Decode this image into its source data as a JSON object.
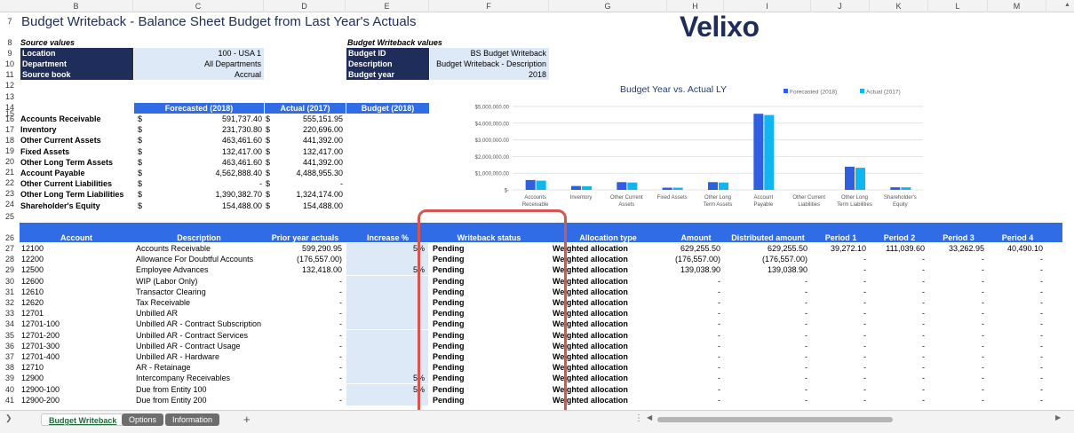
{
  "column_letters": [
    "B",
    "C",
    "D",
    "E",
    "F",
    "G",
    "H",
    "I",
    "J",
    "K",
    "L",
    "M"
  ],
  "title": "Budget Writeback - Balance Sheet Budget from Last Year's Actuals",
  "logo": "Velixo",
  "source_values": {
    "header": "Source values",
    "rows": [
      {
        "label": "Location",
        "value": "100 - USA 1"
      },
      {
        "label": "Department",
        "value": "All Departments"
      },
      {
        "label": "Source book",
        "value": "Accrual"
      }
    ]
  },
  "writeback_values": {
    "header": "Budget Writeback values",
    "rows": [
      {
        "label": "Budget ID",
        "value": "BS Budget Writeback"
      },
      {
        "label": "Description",
        "value": "Budget Writeback - Description"
      },
      {
        "label": "Budget year",
        "value": "2018"
      }
    ]
  },
  "summary": {
    "headers": [
      "Forecasted (2018)",
      "Actual (2017)",
      "Budget (2018)"
    ],
    "rows": [
      {
        "label": "Accounts Receivable",
        "cur1": "$",
        "forecast": "591,737.40",
        "cur2": "$",
        "actual": "555,151.95"
      },
      {
        "label": "Inventory",
        "cur1": "$",
        "forecast": "231,730.80",
        "cur2": "$",
        "actual": "220,696.00"
      },
      {
        "label": "Other Current Assets",
        "cur1": "$",
        "forecast": "463,461.60",
        "cur2": "$",
        "actual": "441,392.00"
      },
      {
        "label": "Fixed Assets",
        "cur1": "$",
        "forecast": "132,417.00",
        "cur2": "$",
        "actual": "132,417.00"
      },
      {
        "label": "Other Long Term Assets",
        "cur1": "$",
        "forecast": "463,461.60",
        "cur2": "$",
        "actual": "441,392.00"
      },
      {
        "label": "Account Payable",
        "cur1": "$",
        "forecast": "4,562,888.40",
        "cur2": "$",
        "actual": "4,488,955.30"
      },
      {
        "label": "Other Current Liabilities",
        "cur1": "$",
        "forecast": "-",
        "cur2": "$",
        "actual": "-"
      },
      {
        "label": "Other Long Term Liabilities",
        "cur1": "$",
        "forecast": "1,390,382.70",
        "cur2": "$",
        "actual": "1,324,174.00"
      },
      {
        "label": "Shareholder's Equity",
        "cur1": "$",
        "forecast": "154,488.00",
        "cur2": "$",
        "actual": "154,488.00"
      }
    ]
  },
  "chart_data": {
    "type": "bar",
    "title": "Budget Year vs. Actual LY",
    "categories": [
      "Accounts Receivable",
      "Inventory",
      "Other Current Assets",
      "Fixed Assets",
      "Other Long Term Assets",
      "Account Payable",
      "Other Current Liabilities",
      "Other Long Term Liabilities",
      "Shareholder's Equity"
    ],
    "category_lines": [
      [
        "Accounts",
        "Receivable"
      ],
      [
        "Inventory"
      ],
      [
        "Other Current",
        "Assets"
      ],
      [
        "Fixed Assets"
      ],
      [
        "Other Long",
        "Term Assets"
      ],
      [
        "Account",
        "Payable"
      ],
      [
        "Other Current",
        "Liabilities"
      ],
      [
        "Other Long",
        "Term Liabilities"
      ],
      [
        "Shareholder's",
        "Equity"
      ]
    ],
    "series": [
      {
        "name": "Forecasted (2018)",
        "color": "#2f5fe0",
        "values": [
          591737.4,
          231730.8,
          463461.6,
          132417.0,
          463461.6,
          4562888.4,
          0,
          1390382.7,
          154488.0
        ]
      },
      {
        "name": "Actual (2017)",
        "color": "#11b5f0",
        "values": [
          555151.95,
          220696.0,
          441392.0,
          132417.0,
          441392.0,
          4488955.3,
          0,
          1324174.0,
          154488.0
        ]
      }
    ],
    "yticks": [
      "$-",
      "$1,000,000.00",
      "$2,000,000.00",
      "$3,000,000.00",
      "$4,000,000.00",
      "$5,000,000.00"
    ],
    "ylim": [
      0,
      5000000
    ],
    "legend": "top-right",
    "grid": true
  },
  "table": {
    "headers": [
      "Account",
      "Description",
      "Prior year actuals",
      "Increase %",
      "Writeback status",
      "Allocation type",
      "Amount",
      "Distributed amount",
      "Period 1",
      "Period 2",
      "Period 3",
      "Period 4"
    ],
    "rows": [
      {
        "row": "27",
        "account": "12100",
        "desc": "Accounts Receivable",
        "prior": "599,290.95",
        "inc": "5%",
        "status": "Pending",
        "alloc": "Weighted allocation",
        "amount": "629,255.50",
        "dist": "629,255.50",
        "p1": "39,272.10",
        "p2": "111,039.60",
        "p3": "33,262.95",
        "p4": "40,490.10"
      },
      {
        "row": "28",
        "account": "12200",
        "desc": "Allowance For Doubtful Accounts",
        "prior": "(176,557.00)",
        "inc": "",
        "status": "Pending",
        "alloc": "Weighted allocation",
        "amount": "(176,557.00)",
        "dist": "(176,557.00)",
        "p1": "-",
        "p2": "-",
        "p3": "-",
        "p4": "-"
      },
      {
        "row": "29",
        "account": "12500",
        "desc": "Employee Advances",
        "prior": "132,418.00",
        "inc": "5%",
        "status": "Pending",
        "alloc": "Weighted allocation",
        "amount": "139,038.90",
        "dist": "139,038.90",
        "p1": "-",
        "p2": "-",
        "p3": "-",
        "p4": "-"
      },
      {
        "row": "30",
        "account": "12600",
        "desc": "WIP (Labor Only)",
        "prior": "-",
        "inc": "",
        "status": "Pending",
        "alloc": "Weighted allocation",
        "amount": "-",
        "dist": "-",
        "p1": "-",
        "p2": "-",
        "p3": "-",
        "p4": "-"
      },
      {
        "row": "31",
        "account": "12610",
        "desc": "Transactor Clearing",
        "prior": "-",
        "inc": "",
        "status": "Pending",
        "alloc": "Weighted allocation",
        "amount": "-",
        "dist": "-",
        "p1": "-",
        "p2": "-",
        "p3": "-",
        "p4": "-"
      },
      {
        "row": "32",
        "account": "12620",
        "desc": "Tax Receivable",
        "prior": "-",
        "inc": "",
        "status": "Pending",
        "alloc": "Weighted allocation",
        "amount": "-",
        "dist": "-",
        "p1": "-",
        "p2": "-",
        "p3": "-",
        "p4": "-"
      },
      {
        "row": "33",
        "account": "12701",
        "desc": "Unbilled AR",
        "prior": "-",
        "inc": "",
        "status": "Pending",
        "alloc": "Weighted allocation",
        "amount": "-",
        "dist": "-",
        "p1": "-",
        "p2": "-",
        "p3": "-",
        "p4": "-"
      },
      {
        "row": "34",
        "account": "12701-100",
        "desc": "Unbilled AR - Contract Subscription",
        "prior": "-",
        "inc": "",
        "status": "Pending",
        "alloc": "Weighted allocation",
        "amount": "-",
        "dist": "-",
        "p1": "-",
        "p2": "-",
        "p3": "-",
        "p4": "-"
      },
      {
        "row": "35",
        "account": "12701-200",
        "desc": "Unbilled AR - Contract Services",
        "prior": "-",
        "inc": "",
        "status": "Pending",
        "alloc": "Weighted allocation",
        "amount": "-",
        "dist": "-",
        "p1": "-",
        "p2": "-",
        "p3": "-",
        "p4": "-"
      },
      {
        "row": "36",
        "account": "12701-300",
        "desc": "Unbilled AR - Contract Usage",
        "prior": "-",
        "inc": "",
        "status": "Pending",
        "alloc": "Weighted allocation",
        "amount": "-",
        "dist": "-",
        "p1": "-",
        "p2": "-",
        "p3": "-",
        "p4": "-"
      },
      {
        "row": "37",
        "account": "12701-400",
        "desc": "Unbilled AR - Hardware",
        "prior": "-",
        "inc": "",
        "status": "Pending",
        "alloc": "Weighted allocation",
        "amount": "-",
        "dist": "-",
        "p1": "-",
        "p2": "-",
        "p3": "-",
        "p4": "-"
      },
      {
        "row": "38",
        "account": "12710",
        "desc": "AR - Retainage",
        "prior": "-",
        "inc": "",
        "status": "Pending",
        "alloc": "Weighted allocation",
        "amount": "-",
        "dist": "-",
        "p1": "-",
        "p2": "-",
        "p3": "-",
        "p4": "-"
      },
      {
        "row": "39",
        "account": "12900",
        "desc": "Intercompany Receivables",
        "prior": "-",
        "inc": "5%",
        "status": "Pending",
        "alloc": "Weighted allocation",
        "amount": "-",
        "dist": "-",
        "p1": "-",
        "p2": "-",
        "p3": "-",
        "p4": "-"
      },
      {
        "row": "40",
        "account": "12900-100",
        "desc": "Due from Entity 100",
        "prior": "-",
        "inc": "5%",
        "status": "Pending",
        "alloc": "Weighted allocation",
        "amount": "-",
        "dist": "-",
        "p1": "-",
        "p2": "-",
        "p3": "-",
        "p4": "-"
      },
      {
        "row": "41",
        "account": "12900-200",
        "desc": "Due from Entity 200",
        "prior": "-",
        "inc": "",
        "status": "Pending",
        "alloc": "Weighted allocation",
        "amount": "-",
        "dist": "-",
        "p1": "-",
        "p2": "-",
        "p3": "-",
        "p4": "-"
      }
    ]
  },
  "row_numbers_top": [
    "7",
    "8",
    "9",
    "10",
    "11",
    "12",
    "13",
    "14",
    "15",
    "16",
    "17",
    "18",
    "19",
    "20",
    "21",
    "22",
    "23",
    "24",
    "25",
    "26"
  ],
  "sheet_tabs": {
    "active": "Budget Writeback",
    "others": [
      "Options",
      "Information"
    ],
    "add": "+"
  }
}
